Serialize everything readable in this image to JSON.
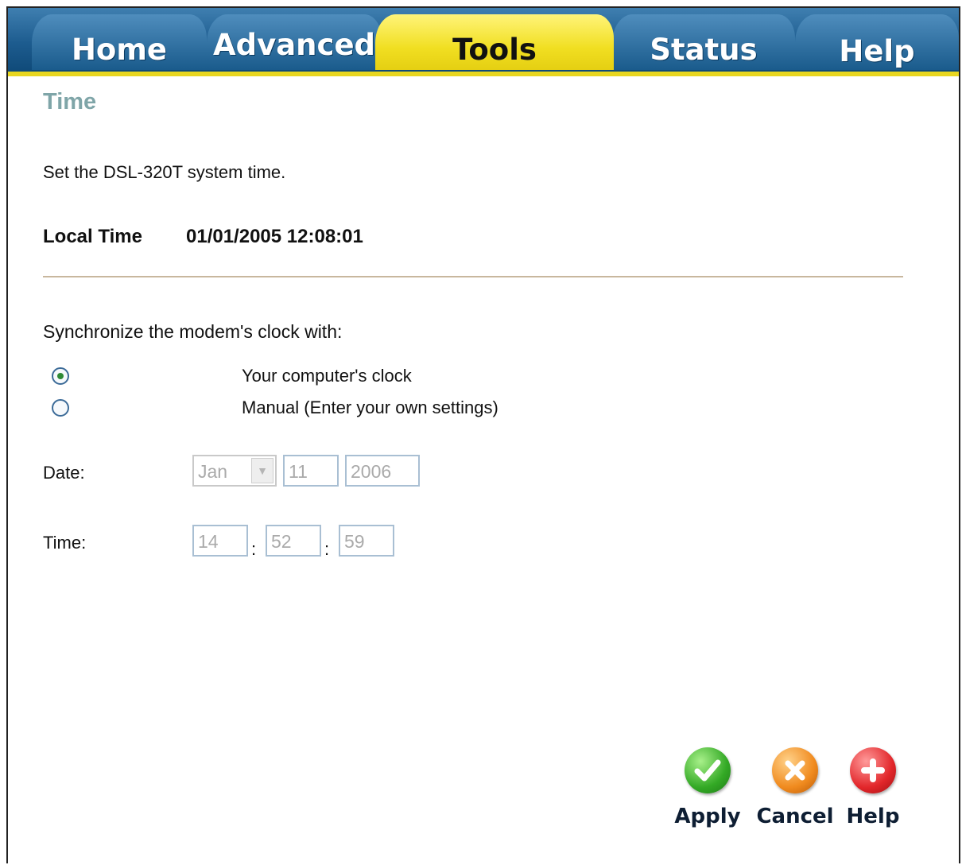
{
  "tabs": {
    "home": "Home",
    "advanced": "Advanced",
    "tools": "Tools",
    "status": "Status",
    "help": "Help",
    "active": "Tools"
  },
  "page": {
    "title": "Time",
    "description": "Set the DSL-320T system time.",
    "local_time_label": "Local Time",
    "local_time_value": "01/01/2005 12:08:01"
  },
  "sync": {
    "label": "Synchronize the modem's clock with:",
    "option_computer": "Your computer's clock",
    "option_manual": "Manual (Enter your own settings)",
    "selected": "Your computer's clock"
  },
  "date": {
    "label": "Date:",
    "month": "Jan",
    "day": "11",
    "year": "2006"
  },
  "time": {
    "label": "Time:",
    "hour": "14",
    "minute": "52",
    "second": "59",
    "separator": ":"
  },
  "actions": {
    "apply": "Apply",
    "cancel": "Cancel",
    "help": "Help"
  },
  "icons": {
    "apply": "checkmark-icon",
    "cancel": "x-icon",
    "help": "plus-icon"
  },
  "colors": {
    "tab_blue": "#1d5c8f",
    "tab_active_yellow": "#f1df22",
    "title_teal": "#7fa5a8",
    "apply_green": "#33a925",
    "cancel_orange": "#f08a1e",
    "help_red": "#e2262a"
  }
}
